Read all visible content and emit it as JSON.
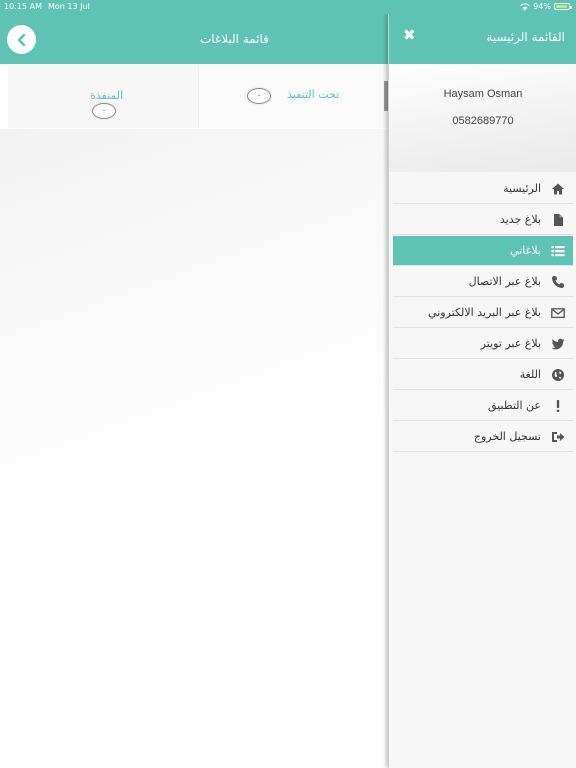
{
  "status_bar": {
    "time": "10:15 AM",
    "date": "Mon 13 Jul",
    "battery": "94%",
    "battery_level": 0.94
  },
  "main": {
    "title": "قائمة البلاغات",
    "tabs": [
      {
        "label": "تحت التنفيذ",
        "count": "٠"
      },
      {
        "label": "المنفذة",
        "count": "٠"
      }
    ]
  },
  "drawer": {
    "title": "القائمة الرئيسية",
    "user_name": "Haysam Osman",
    "user_phone": "0582689770",
    "items": [
      {
        "label": "الرئيسية",
        "icon": "home-icon"
      },
      {
        "label": "بلاغ جديد",
        "icon": "document-icon"
      },
      {
        "label": "بلاغاتي",
        "icon": "list-icon",
        "active": true
      },
      {
        "label": "بلاغ عبر الاتصال",
        "icon": "phone-icon"
      },
      {
        "label": "بلاغ عبر البريد الالكتروني",
        "icon": "envelope-icon"
      },
      {
        "label": "بلاغ عبر تويتر",
        "icon": "twitter-icon"
      },
      {
        "label": "اللغة",
        "icon": "globe-icon"
      },
      {
        "label": "عن التطبيق",
        "icon": "exclamation-icon"
      },
      {
        "label": "تسجيل الخروج",
        "icon": "logout-icon"
      }
    ]
  },
  "colors": {
    "accent": "#5ec3b5",
    "active_item_text": "#ffffff",
    "text": "#333333"
  }
}
